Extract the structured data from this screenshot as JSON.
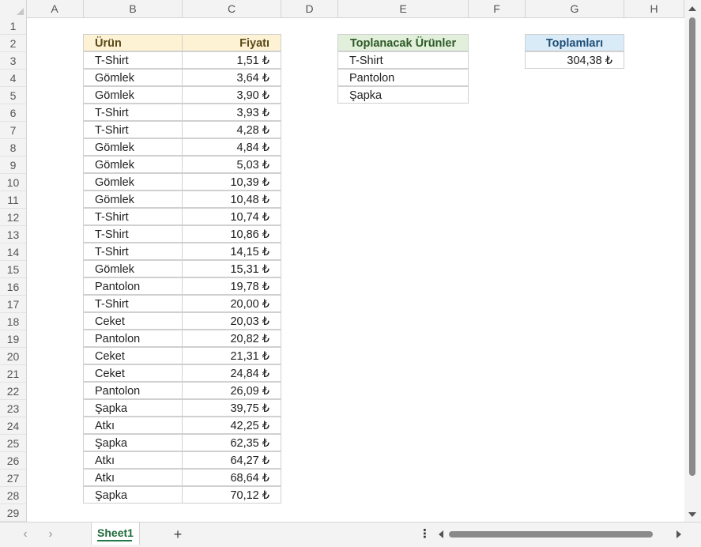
{
  "columns": [
    "A",
    "B",
    "C",
    "D",
    "E",
    "F",
    "G",
    "H"
  ],
  "rows": [
    "1",
    "2",
    "3",
    "4",
    "5",
    "6",
    "7",
    "8",
    "9",
    "10",
    "11",
    "12",
    "13",
    "14",
    "15",
    "16",
    "17",
    "18",
    "19",
    "20",
    "21",
    "22",
    "23",
    "24",
    "25",
    "26",
    "27",
    "28",
    "29"
  ],
  "table_products": {
    "header_product": "Ürün",
    "header_price": "Fiyatı",
    "items": [
      {
        "product": "T-Shirt",
        "price": "1,51 ₺"
      },
      {
        "product": "Gömlek",
        "price": "3,64 ₺"
      },
      {
        "product": "Gömlek",
        "price": "3,90 ₺"
      },
      {
        "product": "T-Shirt",
        "price": "3,93 ₺"
      },
      {
        "product": "T-Shirt",
        "price": "4,28 ₺"
      },
      {
        "product": "Gömlek",
        "price": "4,84 ₺"
      },
      {
        "product": "Gömlek",
        "price": "5,03 ₺"
      },
      {
        "product": "Gömlek",
        "price": "10,39 ₺"
      },
      {
        "product": "Gömlek",
        "price": "10,48 ₺"
      },
      {
        "product": "T-Shirt",
        "price": "10,74 ₺"
      },
      {
        "product": "T-Shirt",
        "price": "10,86 ₺"
      },
      {
        "product": "T-Shirt",
        "price": "14,15 ₺"
      },
      {
        "product": "Gömlek",
        "price": "15,31 ₺"
      },
      {
        "product": "Pantolon",
        "price": "19,78 ₺"
      },
      {
        "product": "T-Shirt",
        "price": "20,00 ₺"
      },
      {
        "product": "Ceket",
        "price": "20,03 ₺"
      },
      {
        "product": "Pantolon",
        "price": "20,82 ₺"
      },
      {
        "product": "Ceket",
        "price": "21,31 ₺"
      },
      {
        "product": "Ceket",
        "price": "24,84 ₺"
      },
      {
        "product": "Pantolon",
        "price": "26,09 ₺"
      },
      {
        "product": "Şapka",
        "price": "39,75 ₺"
      },
      {
        "product": "Atkı",
        "price": "42,25 ₺"
      },
      {
        "product": "Şapka",
        "price": "62,35 ₺"
      },
      {
        "product": "Atkı",
        "price": "64,27 ₺"
      },
      {
        "product": "Atkı",
        "price": "68,64 ₺"
      },
      {
        "product": "Şapka",
        "price": "70,12 ₺"
      }
    ]
  },
  "table_sum_items": {
    "header": "Toplanacak Ürünler",
    "items": [
      "T-Shirt",
      "Pantolon",
      "Şapka"
    ]
  },
  "table_total": {
    "header": "Toplamları",
    "value": "304,38 ₺"
  },
  "sheet_tabs": [
    "Sheet1"
  ],
  "icons": {
    "prev_sheet": "chevron-left-icon",
    "next_sheet": "chevron-right-icon",
    "add_sheet": "plus-icon",
    "more": "more-options-icon"
  },
  "colors": {
    "header_product_bg": "#fdf2d4",
    "header_sum_items_bg": "#e1efdb",
    "header_total_bg": "#d9ebf6",
    "sheet_tab_accent": "#1f7a45"
  }
}
